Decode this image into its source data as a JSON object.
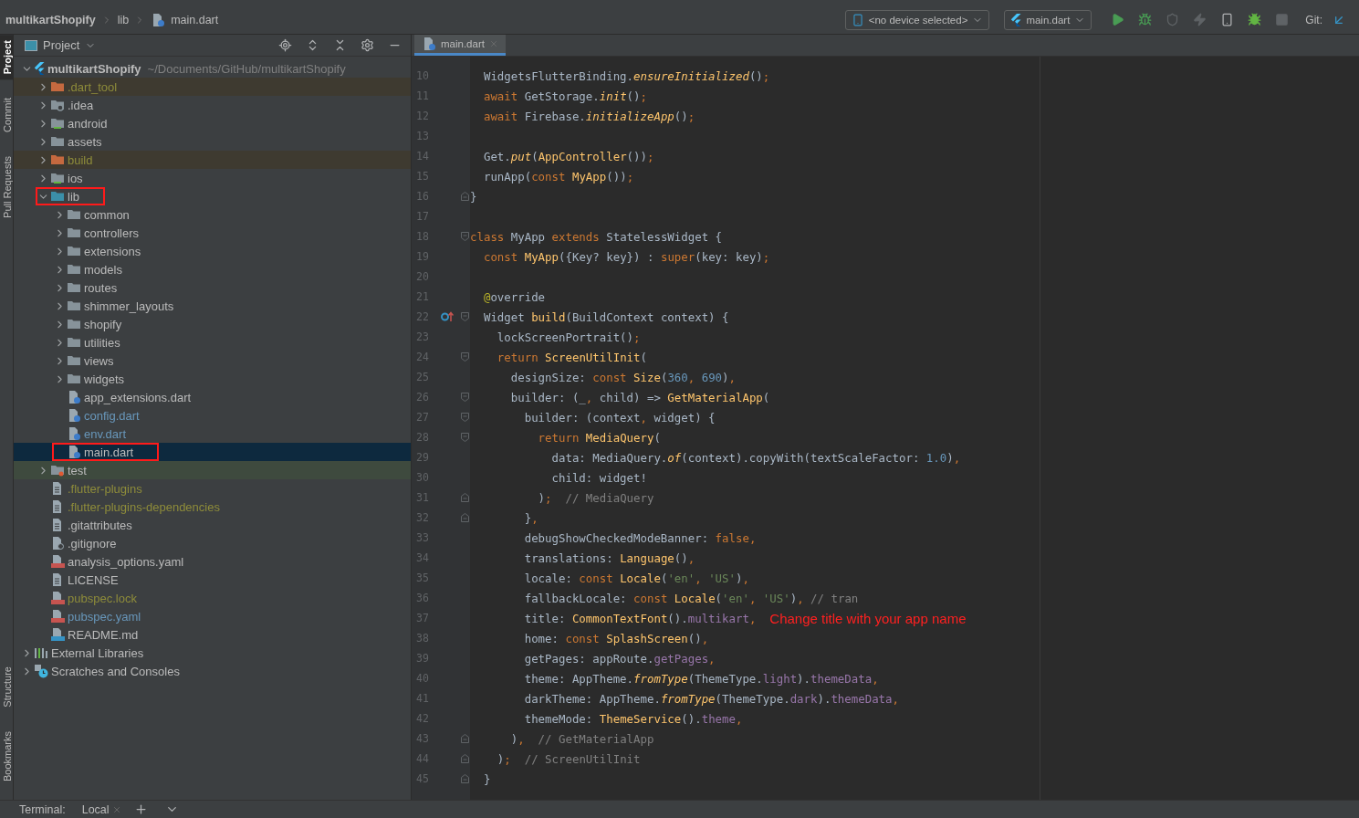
{
  "breadcrumbs": [
    {
      "label": "multikartShopify",
      "kind": "project"
    },
    {
      "label": "lib",
      "kind": "folder"
    },
    {
      "label": "main.dart",
      "kind": "dart"
    }
  ],
  "toolbar": {
    "device": "<no device selected>",
    "config": "main.dart",
    "actions": [
      {
        "kind": "run",
        "disabled": false
      },
      {
        "kind": "debug",
        "disabled": false
      },
      {
        "kind": "coverage",
        "disabled": true
      },
      {
        "kind": "hot-reload",
        "disabled": true
      },
      {
        "kind": "device-manager",
        "disabled": false
      },
      {
        "kind": "attach",
        "disabled": false
      },
      {
        "kind": "stop",
        "disabled": true
      }
    ],
    "git_label": "Git:"
  },
  "tool_tabs_top": [
    {
      "label": "Project",
      "selected": true
    },
    {
      "label": "Commit",
      "selected": false
    },
    {
      "label": "Pull Requests",
      "selected": false
    }
  ],
  "tool_tabs_bottom": [
    {
      "label": "Structure",
      "selected": false
    },
    {
      "label": "Bookmarks",
      "selected": false
    }
  ],
  "project_panel": {
    "title": "Project"
  },
  "tree": [
    {
      "label": "multikartShopify",
      "path": "~/Documents/GitHub/multikartShopify",
      "kind": "flutter",
      "ignored": false,
      "modified": false,
      "selected": false,
      "marked": false,
      "expanded": true,
      "children": [
        {
          "label": ".dart_tool",
          "kind": "excluded",
          "ignored": true,
          "modified": false,
          "selected": false,
          "marked": false,
          "expanded": false
        },
        {
          "label": ".idea",
          "kind": "idea",
          "ignored": false,
          "modified": false,
          "selected": false,
          "marked": false,
          "expanded": false
        },
        {
          "label": "android",
          "kind": "module",
          "ignored": false,
          "modified": false,
          "selected": false,
          "marked": false,
          "expanded": false
        },
        {
          "label": "assets",
          "kind": "folder",
          "ignored": false,
          "modified": false,
          "selected": false,
          "marked": false,
          "expanded": false
        },
        {
          "label": "build",
          "kind": "excluded",
          "ignored": true,
          "modified": false,
          "selected": false,
          "marked": false,
          "expanded": false
        },
        {
          "label": "ios",
          "kind": "module",
          "ignored": false,
          "modified": false,
          "selected": false,
          "marked": false,
          "expanded": false
        },
        {
          "label": "lib",
          "kind": "source",
          "ignored": false,
          "modified": false,
          "selected": false,
          "marked": true,
          "expanded": true,
          "children": [
            {
              "label": "common",
              "kind": "folder",
              "ignored": false,
              "modified": false,
              "selected": false,
              "marked": false,
              "expanded": false
            },
            {
              "label": "controllers",
              "kind": "folder",
              "ignored": false,
              "modified": false,
              "selected": false,
              "marked": false,
              "expanded": false
            },
            {
              "label": "extensions",
              "kind": "folder",
              "ignored": false,
              "modified": false,
              "selected": false,
              "marked": false,
              "expanded": false
            },
            {
              "label": "models",
              "kind": "folder",
              "ignored": false,
              "modified": false,
              "selected": false,
              "marked": false,
              "expanded": false
            },
            {
              "label": "routes",
              "kind": "folder",
              "ignored": false,
              "modified": false,
              "selected": false,
              "marked": false,
              "expanded": false
            },
            {
              "label": "shimmer_layouts",
              "kind": "folder",
              "ignored": false,
              "modified": false,
              "selected": false,
              "marked": false,
              "expanded": false
            },
            {
              "label": "shopify",
              "kind": "folder",
              "ignored": false,
              "modified": false,
              "selected": false,
              "marked": false,
              "expanded": false
            },
            {
              "label": "utilities",
              "kind": "folder",
              "ignored": false,
              "modified": false,
              "selected": false,
              "marked": false,
              "expanded": false
            },
            {
              "label": "views",
              "kind": "folder",
              "ignored": false,
              "modified": false,
              "selected": false,
              "marked": false,
              "expanded": false
            },
            {
              "label": "widgets",
              "kind": "folder",
              "ignored": false,
              "modified": false,
              "selected": false,
              "marked": false,
              "expanded": false
            },
            {
              "label": "app_extensions.dart",
              "kind": "dart",
              "ignored": false,
              "modified": false,
              "selected": false,
              "marked": false
            },
            {
              "label": "config.dart",
              "kind": "dart",
              "ignored": false,
              "modified": true,
              "selected": false,
              "marked": false
            },
            {
              "label": "env.dart",
              "kind": "dart",
              "ignored": false,
              "modified": true,
              "selected": false,
              "marked": false
            },
            {
              "label": "main.dart",
              "kind": "dart",
              "ignored": false,
              "modified": false,
              "selected": true,
              "marked": true
            }
          ]
        },
        {
          "label": "test",
          "kind": "test-folder",
          "ignored": false,
          "modified": false,
          "selected": false,
          "marked": false,
          "expanded": false
        },
        {
          "label": ".flutter-plugins",
          "kind": "text",
          "ignored": true,
          "modified": false,
          "selected": false,
          "marked": false
        },
        {
          "label": ".flutter-plugins-dependencies",
          "kind": "text",
          "ignored": true,
          "modified": false,
          "selected": false,
          "marked": false
        },
        {
          "label": ".gitattributes",
          "kind": "text",
          "ignored": false,
          "modified": false,
          "selected": false,
          "marked": false
        },
        {
          "label": ".gitignore",
          "kind": "gitignore",
          "ignored": false,
          "modified": false,
          "selected": false,
          "marked": false
        },
        {
          "label": "analysis_options.yaml",
          "kind": "yaml",
          "ignored": false,
          "modified": false,
          "selected": false,
          "marked": false
        },
        {
          "label": "LICENSE",
          "kind": "text",
          "ignored": false,
          "modified": false,
          "selected": false,
          "marked": false
        },
        {
          "label": "pubspec.lock",
          "kind": "yaml",
          "ignored": true,
          "modified": false,
          "selected": false,
          "marked": false
        },
        {
          "label": "pubspec.yaml",
          "kind": "yaml",
          "ignored": false,
          "modified": true,
          "selected": false,
          "marked": false
        },
        {
          "label": "README.md",
          "kind": "markdown",
          "ignored": false,
          "modified": false,
          "selected": false,
          "marked": false
        }
      ]
    },
    {
      "label": "External Libraries",
      "kind": "libraries",
      "ignored": false,
      "modified": false,
      "selected": false,
      "marked": false,
      "expanded": false
    },
    {
      "label": "Scratches and Consoles",
      "kind": "scratches",
      "ignored": false,
      "modified": false,
      "selected": false,
      "marked": false,
      "expanded": false
    }
  ],
  "editor": {
    "tab": {
      "label": "main.dart",
      "selected": true
    },
    "lines": [
      {
        "number": "10",
        "fold_start": false,
        "fold_end": false,
        "override": false,
        "text": "  WidgetsFlutterBinding.ensureInitialized();"
      },
      {
        "number": "11",
        "fold_start": false,
        "fold_end": false,
        "override": false,
        "text": "  await GetStorage.init();"
      },
      {
        "number": "12",
        "fold_start": false,
        "fold_end": false,
        "override": false,
        "text": "  await Firebase.initializeApp();"
      },
      {
        "number": "13",
        "fold_start": false,
        "fold_end": false,
        "override": false
      },
      {
        "number": "14",
        "fold_start": false,
        "fold_end": false,
        "override": false,
        "text": "  Get.put(AppController());"
      },
      {
        "number": "15",
        "fold_start": false,
        "fold_end": false,
        "override": false,
        "text": "  runApp(const MyApp());"
      },
      {
        "number": "16",
        "fold_start": false,
        "fold_end": true,
        "override": false,
        "text": "}"
      },
      {
        "number": "17",
        "fold_start": false,
        "fold_end": false,
        "override": false
      },
      {
        "number": "18",
        "fold_start": true,
        "fold_end": false,
        "override": false,
        "text": "class MyApp extends StatelessWidget {"
      },
      {
        "number": "19",
        "fold_start": false,
        "fold_end": false,
        "override": false,
        "text": "  const MyApp({Key? key}) : super(key: key);"
      },
      {
        "number": "20",
        "fold_start": false,
        "fold_end": false,
        "override": false
      },
      {
        "number": "21",
        "fold_start": false,
        "fold_end": false,
        "override": false,
        "text": "  @override"
      },
      {
        "number": "22",
        "fold_start": true,
        "fold_end": false,
        "override": true,
        "text": "  Widget build(BuildContext context) {"
      },
      {
        "number": "23",
        "fold_start": false,
        "fold_end": false,
        "override": false,
        "text": "    lockScreenPortrait();"
      },
      {
        "number": "24",
        "fold_start": true,
        "fold_end": false,
        "override": false,
        "text": "    return ScreenUtilInit("
      },
      {
        "number": "25",
        "fold_start": false,
        "fold_end": false,
        "override": false,
        "text": "      designSize: const Size(360, 690),"
      },
      {
        "number": "26",
        "fold_start": true,
        "fold_end": false,
        "override": false,
        "text": "      builder: (_, child) => GetMaterialApp("
      },
      {
        "number": "27",
        "fold_start": true,
        "fold_end": false,
        "override": false,
        "text": "        builder: (context, widget) {"
      },
      {
        "number": "28",
        "fold_start": true,
        "fold_end": false,
        "override": false,
        "text": "          return MediaQuery("
      },
      {
        "number": "29",
        "fold_start": false,
        "fold_end": false,
        "override": false,
        "text": "            data: MediaQuery.of(context).copyWith(textScaleFactor: 1.0),"
      },
      {
        "number": "30",
        "fold_start": false,
        "fold_end": false,
        "override": false,
        "text": "            child: widget!"
      },
      {
        "number": "31",
        "fold_start": false,
        "fold_end": true,
        "override": false,
        "text": "          );  // MediaQuery"
      },
      {
        "number": "32",
        "fold_start": false,
        "fold_end": true,
        "override": false,
        "text": "        },"
      },
      {
        "number": "33",
        "fold_start": false,
        "fold_end": false,
        "override": false,
        "text": "        debugShowCheckedModeBanner: false,"
      },
      {
        "number": "34",
        "fold_start": false,
        "fold_end": false,
        "override": false,
        "text": "        translations: Language(),"
      },
      {
        "number": "35",
        "fold_start": false,
        "fold_end": false,
        "override": false,
        "text": "        locale: const Locale('en', 'US'),"
      },
      {
        "number": "36",
        "fold_start": false,
        "fold_end": false,
        "override": false,
        "text": "        fallbackLocale: const Locale('en', 'US'), // tran"
      },
      {
        "number": "37",
        "fold_start": false,
        "fold_end": false,
        "override": false,
        "text": "        title: CommonTextFont().multikart,",
        "note": "Change title with your app name"
      },
      {
        "number": "38",
        "fold_start": false,
        "fold_end": false,
        "override": false,
        "text": "        home: const SplashScreen(),"
      },
      {
        "number": "39",
        "fold_start": false,
        "fold_end": false,
        "override": false,
        "text": "        getPages: appRoute.getPages,"
      },
      {
        "number": "40",
        "fold_start": false,
        "fold_end": false,
        "override": false,
        "text": "        theme: AppTheme.fromType(ThemeType.light).themeData,"
      },
      {
        "number": "41",
        "fold_start": false,
        "fold_end": false,
        "override": false,
        "text": "        darkTheme: AppTheme.fromType(ThemeType.dark).themeData,"
      },
      {
        "number": "42",
        "fold_start": false,
        "fold_end": false,
        "override": false,
        "text": "        themeMode: ThemeService().theme,"
      },
      {
        "number": "43",
        "fold_start": false,
        "fold_end": true,
        "override": false,
        "text": "      ),  // GetMaterialApp"
      },
      {
        "number": "44",
        "fold_start": false,
        "fold_end": true,
        "override": false,
        "text": "    );  // ScreenUtilInit"
      },
      {
        "number": "45",
        "fold_start": false,
        "fold_end": true,
        "override": false,
        "text": "  }"
      }
    ]
  },
  "terminal": {
    "label": "Terminal:",
    "tabs": [
      {
        "label": "Local",
        "selected": true
      }
    ]
  }
}
